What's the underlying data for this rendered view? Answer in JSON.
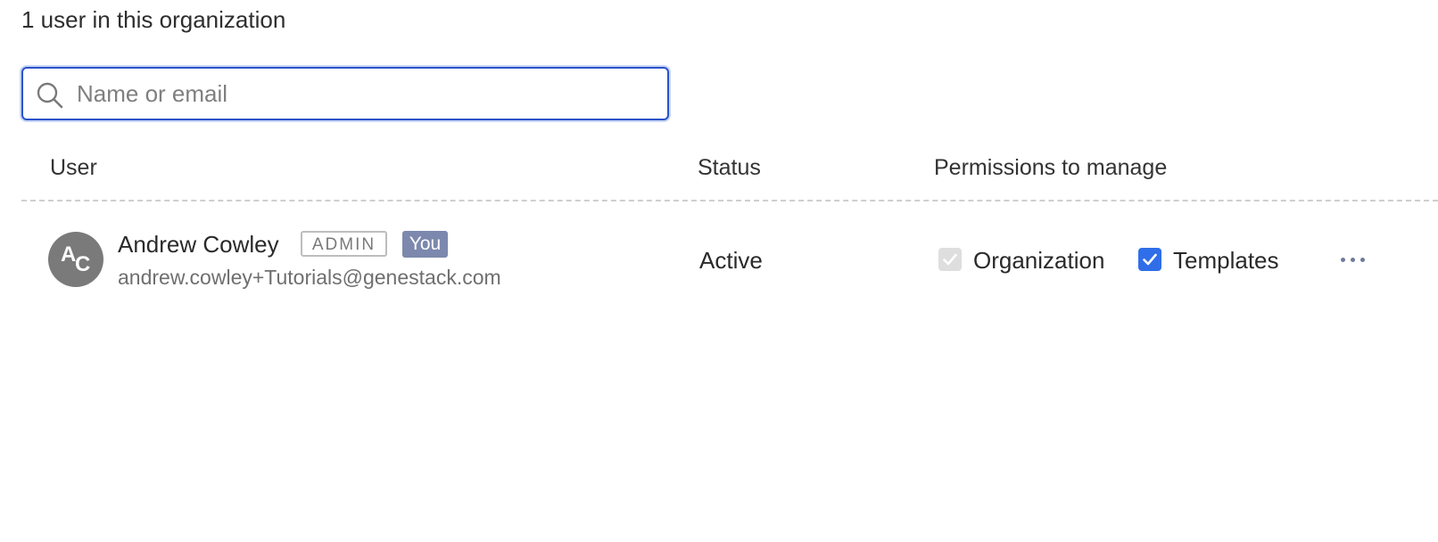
{
  "summary": {
    "count_text": "1 user in this organization"
  },
  "search": {
    "placeholder": "Name or email",
    "value": "",
    "icon": "search-icon"
  },
  "table": {
    "columns": [
      "User",
      "Status",
      "Permissions to manage"
    ],
    "rows": [
      {
        "avatar_initials": [
          "A",
          "C"
        ],
        "name": "Andrew Cowley",
        "role_badge": "ADMIN",
        "self_badge": "You",
        "email": "andrew.cowley+Tutorials@genestack.com",
        "status": "Active",
        "permissions": [
          {
            "label": "Organization",
            "checked": true,
            "disabled": true
          },
          {
            "label": "Templates",
            "checked": true,
            "disabled": false
          }
        ],
        "more_icon": "more-horizontal-icon"
      }
    ]
  },
  "colors": {
    "focus_border": "#2a52c9",
    "checkbox_active": "#2f6ee8",
    "checkbox_disabled": "#dedede",
    "you_badge": "#7c88ad",
    "avatar": "#7a7a7a"
  }
}
